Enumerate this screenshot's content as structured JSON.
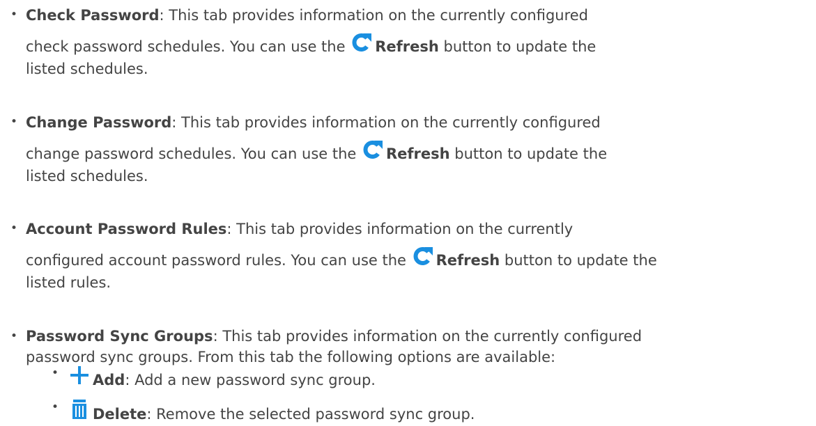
{
  "items": [
    {
      "title": "Check Password",
      "line1": ": This tab provides information on the currently configured",
      "line2_pre": "check password schedules. You can use the ",
      "button": "Refresh",
      "line2_post": " button to update the",
      "line3": "listed schedules."
    },
    {
      "title": "Change Password",
      "line1": ": This tab provides information on the currently configured",
      "line2_pre": "change password schedules. You can use the ",
      "button": "Refresh",
      "line2_post": " button to update the",
      "line3": "listed schedules."
    },
    {
      "title": "Account Password Rules",
      "line1": ": This tab provides information on the currently",
      "line2_pre": "configured account password rules. You can use the ",
      "button": "Refresh",
      "line2_post": " button to update the",
      "line3": "listed rules."
    },
    {
      "title": "Password Sync Groups",
      "line1": ": This tab provides information on the currently configured",
      "line2": "password sync groups. From this tab the following options are available:"
    }
  ],
  "sub_items": [
    {
      "icon": "plus-icon",
      "label": "Add",
      "text": ": Add a new password sync group."
    },
    {
      "icon": "trash-icon",
      "label": "Delete",
      "text": ": Remove the selected password sync group."
    }
  ],
  "colors": {
    "icon_blue": "#1a8fe0",
    "text": "#444444"
  },
  "bullet_char": "•"
}
